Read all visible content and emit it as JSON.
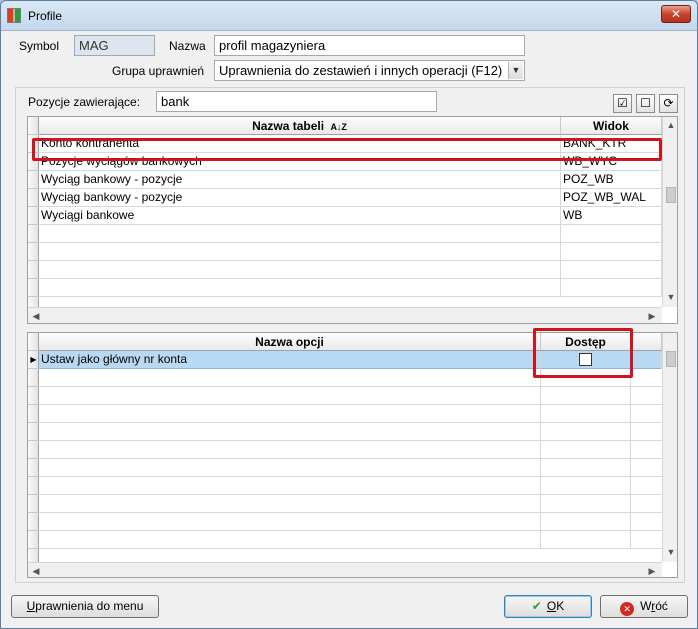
{
  "window": {
    "title": "Profile",
    "close_glyph": "✕"
  },
  "form": {
    "symbol_label": "Symbol",
    "symbol_value": "MAG",
    "nazwa_label": "Nazwa",
    "nazwa_value": "profil magazyniera",
    "grupa_label": "Grupa uprawnień",
    "grupa_value": "Uprawnienia do zestawień i innych operacji (F12)"
  },
  "filter": {
    "label": "Pozycje zawierające:",
    "value": "bank"
  },
  "tables_grid": {
    "headers": [
      "Nazwa tabeli",
      "Widok"
    ],
    "sort_icon": "A↓Z",
    "rows": [
      [
        "Konto kontrahenta",
        "BANK_KTR"
      ],
      [
        "Pozycje wyciągów bankowych",
        "WB_WYC"
      ],
      [
        "Wyciąg bankowy - pozycje",
        "POZ_WB"
      ],
      [
        "Wyciąg bankowy - pozycje",
        "POZ_WB_WAL"
      ],
      [
        "Wyciągi bankowe",
        "WB"
      ]
    ]
  },
  "options_grid": {
    "headers": [
      "Nazwa opcji",
      "Dostęp"
    ],
    "rows": [
      [
        "Ustaw jako główny nr konta"
      ]
    ]
  },
  "buttons": {
    "menu_label_u": "U",
    "menu_label_rest": "prawnienia do menu",
    "ok_label_o": "O",
    "ok_label_rest": "K",
    "cancel_label_a": "W",
    "cancel_label_r": "r",
    "cancel_label_rest": "óć"
  },
  "colors": {
    "highlight": "#d0141c",
    "selected_row": "#b9d9f3"
  }
}
